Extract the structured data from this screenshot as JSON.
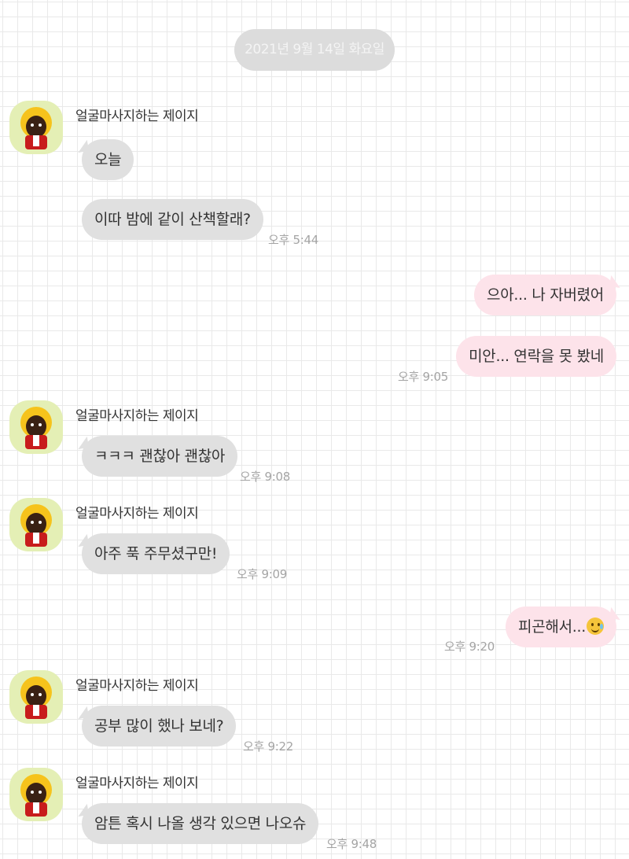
{
  "date": "2021년 9월 14일 화요일",
  "sender_name": "얼굴마사지하는 제이지",
  "messages": {
    "m1": "오늘",
    "m2": "이따 밤에 같이 산책할래?",
    "t1": "오후 5:44",
    "m3": "으아... 나 자버렸어",
    "m4": "미안... 연락을 못 봤네",
    "t2": "오후 9:05",
    "m5": "ㅋㅋㅋ 괜찮아 괜찮아",
    "t3": "오후 9:08",
    "m6": "아주 푹 주무셨구만!",
    "t4": "오후 9:09",
    "m7": "피곤해서...",
    "m7_emoji": "smiling-face-with-tear-icon",
    "t5": "오후 9:20",
    "m8": "공부 많이 했나 보네?",
    "t6": "오후 9:22",
    "m9": "암튼 혹시 나올 생각 있으면 나오슈",
    "t7": "오후 9:48"
  },
  "colors": {
    "incoming_bubble": "#e0e0e0",
    "outgoing_bubble": "#fde3ea",
    "avatar_bg": "#e4efb5",
    "date_pill": "#dcdcdc"
  }
}
